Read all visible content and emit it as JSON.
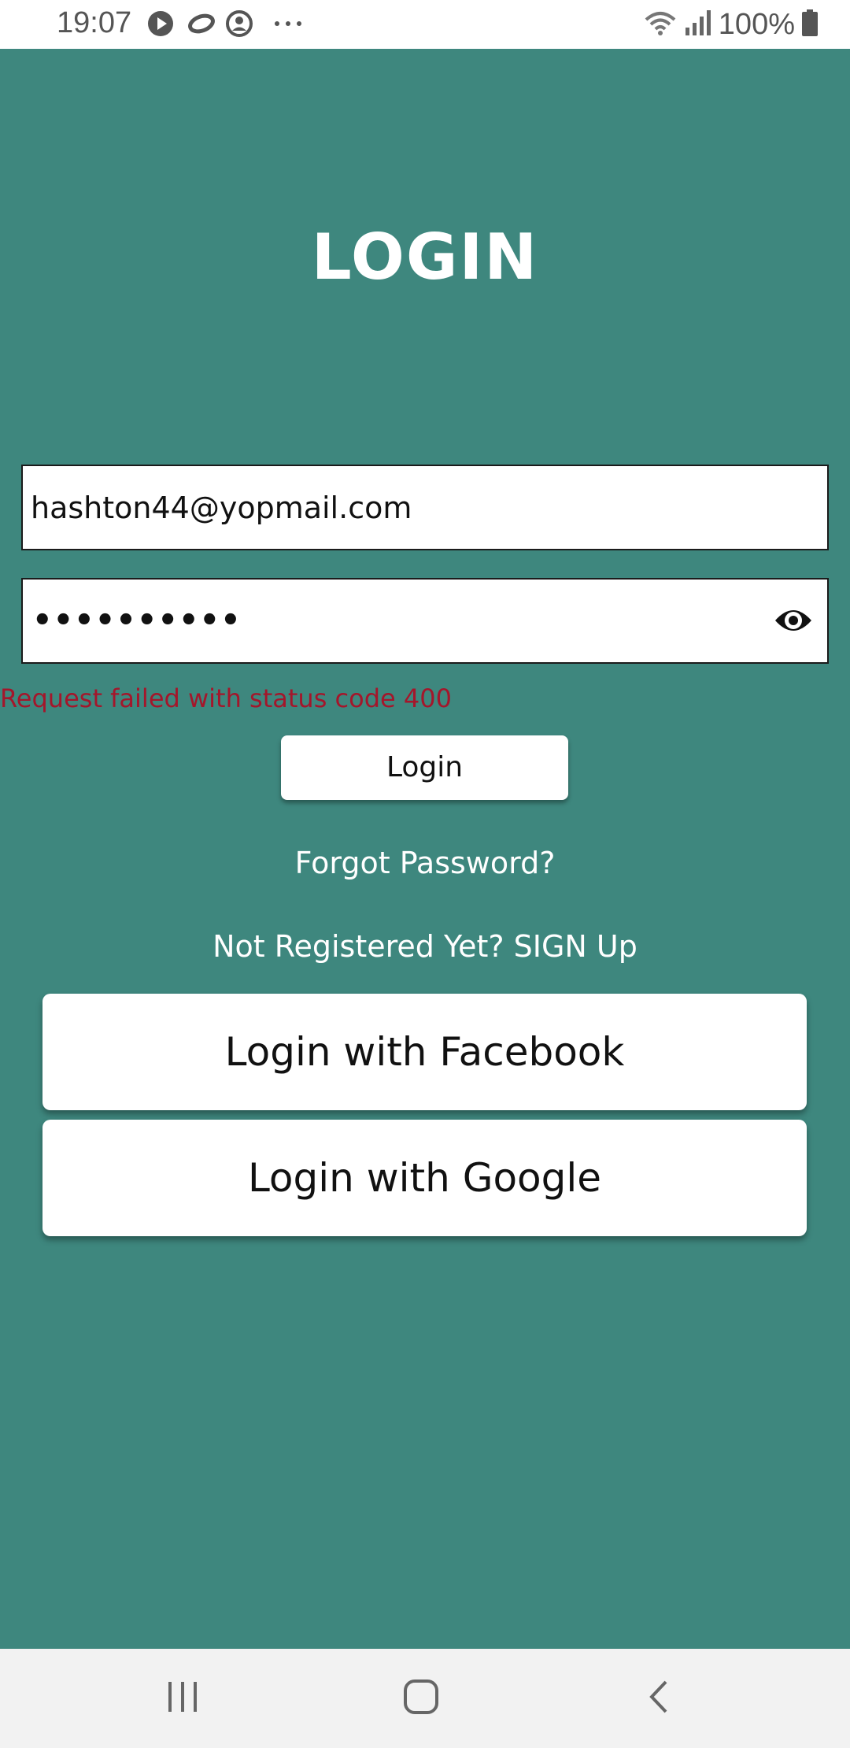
{
  "status_bar": {
    "time": "19:07",
    "battery": "100%",
    "icons": [
      "play-icon",
      "sync-icon",
      "account-icon",
      "more-icon",
      "wifi-icon",
      "signal-icon",
      "battery-icon"
    ]
  },
  "login": {
    "title": "LOGIN",
    "email_value": "hashton44@yopmail.com",
    "password_masked": "••••••••••",
    "error_message": "Request failed with status code 400",
    "login_button": "Login",
    "forgot_password": "Forgot Password?",
    "signup_prompt": "Not Registered Yet? SIGN Up",
    "facebook_button": "Login with Facebook",
    "google_button": "Login with Google"
  },
  "colors": {
    "background": "#3e877e",
    "error": "#a4162b",
    "nav_bar": "#f2f2f2"
  },
  "nav_bar": {
    "icons": [
      "recent-apps-icon",
      "home-icon",
      "back-icon"
    ]
  }
}
